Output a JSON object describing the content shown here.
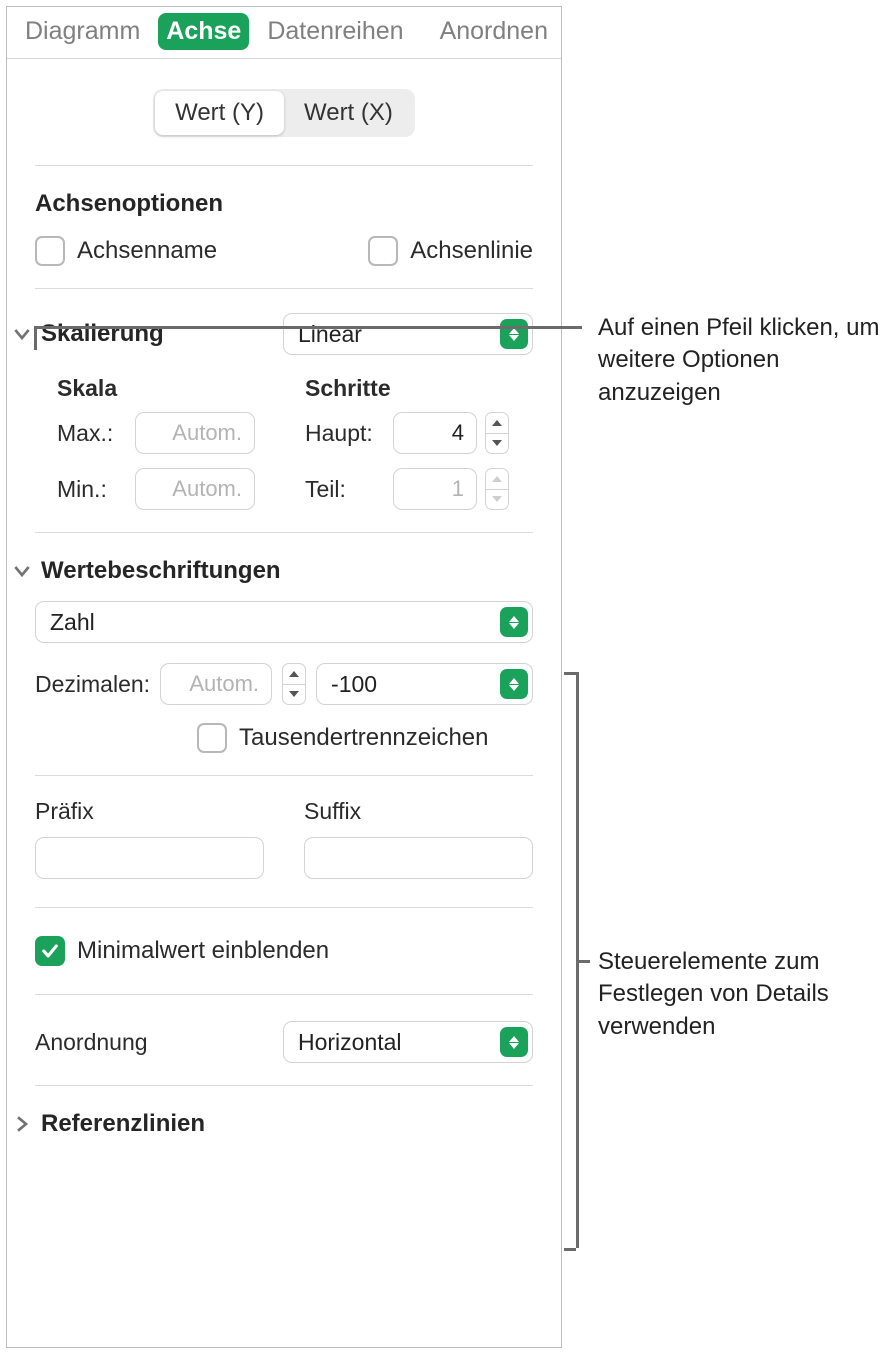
{
  "tabs": {
    "items": [
      "Diagramm",
      "Achse",
      "Datenreihen",
      "Anordnen"
    ],
    "active_index": 1
  },
  "axis_segments": {
    "y": "Wert (Y)",
    "x": "Wert (X)"
  },
  "axis_options": {
    "title": "Achsenoptionen",
    "axis_name": "Achsenname",
    "axis_line": "Achsenlinie"
  },
  "scale": {
    "title": "Skalierung",
    "type": "Linear",
    "scale_label": "Skala",
    "steps_label": "Schritte",
    "max_label": "Max.:",
    "min_label": "Min.:",
    "major_label": "Haupt:",
    "minor_label": "Teil:",
    "auto_placeholder": "Autom.",
    "major_value": "4",
    "minor_value": "1"
  },
  "value_labels": {
    "title": "Wertebeschriftungen",
    "format": "Zahl",
    "decimals_label": "Dezimalen:",
    "decimals_placeholder": "Autom.",
    "neg_format": "-100",
    "thousands": "Tausendertrennzeichen",
    "prefix": "Präfix",
    "suffix": "Suffix",
    "show_min": "Minimalwert einblenden",
    "orientation_label": "Anordnung",
    "orientation_value": "Horizontal"
  },
  "reference_lines": {
    "title": "Referenzlinien"
  },
  "callouts": {
    "arrow_hint": "Auf einen Pfeil klicken, um weitere Optionen anzuzeigen",
    "controls_hint": "Steuerelemente zum Festlegen von Details verwenden"
  }
}
